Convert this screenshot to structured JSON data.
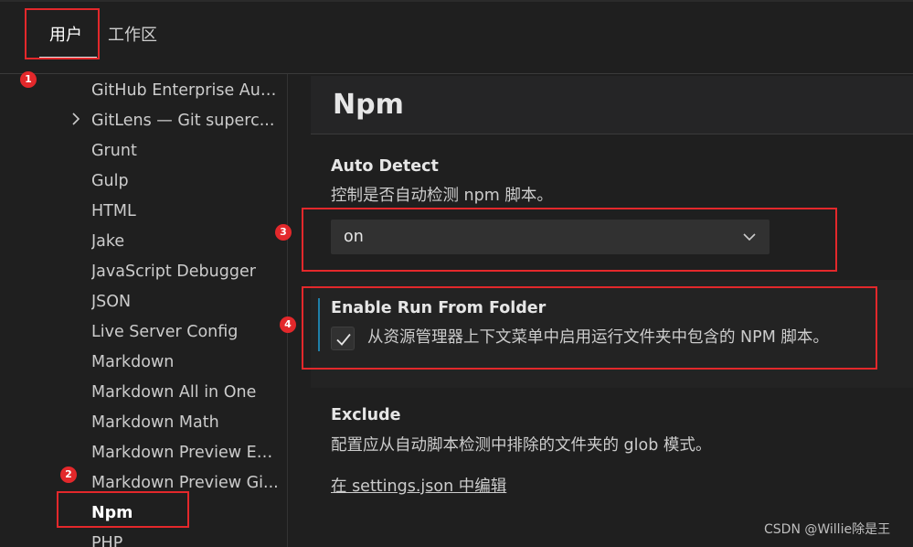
{
  "tabs": {
    "user": "用户",
    "workspace": "工作区"
  },
  "sidebar": {
    "items": [
      {
        "label": "GitHub Enterprise Aut..."
      },
      {
        "label": "GitLens — Git superc..."
      },
      {
        "label": "Grunt"
      },
      {
        "label": "Gulp"
      },
      {
        "label": "HTML"
      },
      {
        "label": "Jake"
      },
      {
        "label": "JavaScript Debugger"
      },
      {
        "label": "JSON"
      },
      {
        "label": "Live Server Config"
      },
      {
        "label": "Markdown"
      },
      {
        "label": "Markdown All in One"
      },
      {
        "label": "Markdown Math"
      },
      {
        "label": "Markdown Preview En..."
      },
      {
        "label": "Markdown Preview Gi..."
      },
      {
        "label": "Npm"
      },
      {
        "label": "PHP"
      }
    ]
  },
  "page": {
    "title": "Npm"
  },
  "settings": {
    "auto_detect": {
      "title": "Auto Detect",
      "desc": "控制是否自动检测 npm 脚本。",
      "value": "on"
    },
    "run_from_folder": {
      "title": "Enable Run From Folder",
      "desc": "从资源管理器上下文菜单中启用运行文件夹中包含的 NPM 脚本。",
      "checked": true
    },
    "exclude": {
      "title": "Exclude",
      "desc": "配置应从自动脚本检测中排除的文件夹的 glob 模式。",
      "link": "在 settings.json 中编辑"
    }
  },
  "annotations": {
    "badges": [
      "1",
      "2",
      "3",
      "4"
    ]
  },
  "watermark": "CSDN @Willie除是王",
  "colors": {
    "annotation_red": "#e3282b",
    "focus_blue": "#1f7fa8",
    "background": "#1f1f1f"
  }
}
